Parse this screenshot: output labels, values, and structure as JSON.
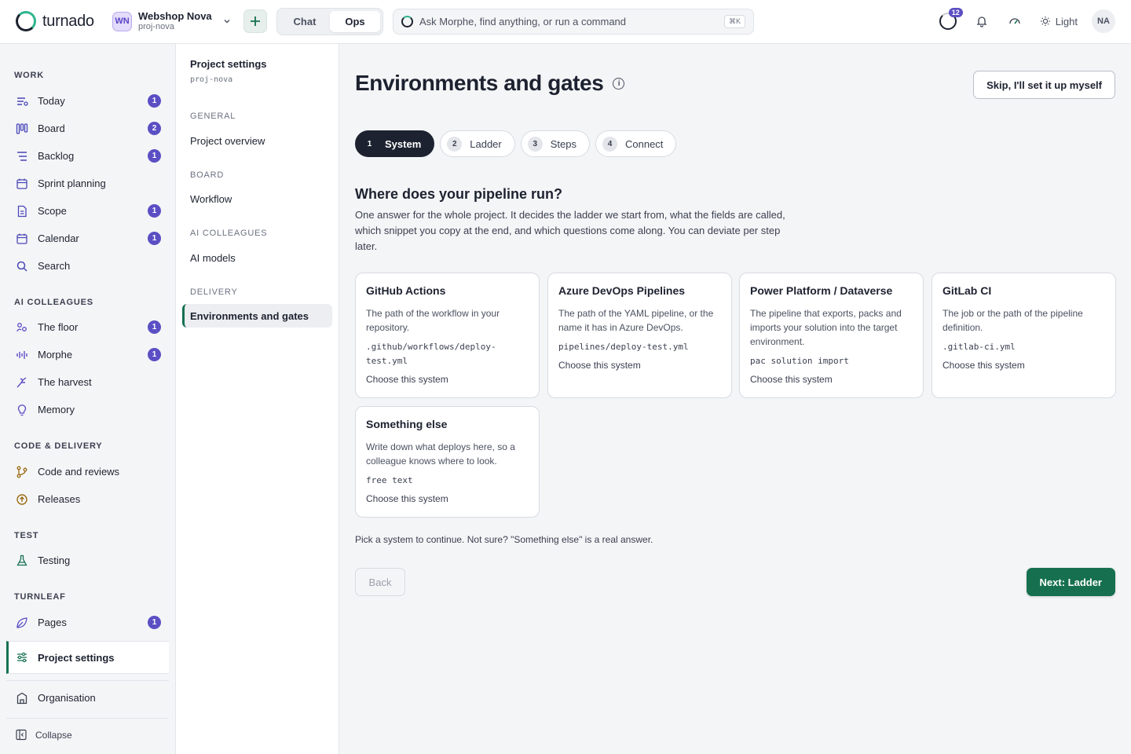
{
  "app": {
    "name": "turnado"
  },
  "workspace": {
    "initials": "WN",
    "name": "Webshop Nova",
    "slug": "proj-nova"
  },
  "mode_switch": {
    "chat": "Chat",
    "ops": "Ops",
    "selected": "Ops"
  },
  "command_bar": {
    "placeholder": "Ask Morphe, find anything, or run a command",
    "shortcut": "⌘K"
  },
  "topbar": {
    "activity_count": "12",
    "theme_label": "Light",
    "user_initials": "NA"
  },
  "nav": {
    "sections": {
      "work": "WORK",
      "ai": "AI COLLEAGUES",
      "code": "CODE & DELIVERY",
      "test": "TEST",
      "turnleaf": "TURNLEAF"
    },
    "items": {
      "today": {
        "label": "Today",
        "badge": "1"
      },
      "board": {
        "label": "Board",
        "badge": "2"
      },
      "backlog": {
        "label": "Backlog",
        "badge": "1"
      },
      "sprint": {
        "label": "Sprint planning"
      },
      "scope": {
        "label": "Scope",
        "badge": "1"
      },
      "calendar": {
        "label": "Calendar",
        "badge": "1"
      },
      "search": {
        "label": "Search"
      },
      "floor": {
        "label": "The floor",
        "badge": "1"
      },
      "morphe": {
        "label": "Morphe",
        "badge": "1"
      },
      "harvest": {
        "label": "The harvest"
      },
      "memory": {
        "label": "Memory"
      },
      "code": {
        "label": "Code and reviews"
      },
      "releases": {
        "label": "Releases"
      },
      "testing": {
        "label": "Testing"
      },
      "pages": {
        "label": "Pages",
        "badge": "1"
      },
      "settings": {
        "label": "Project settings"
      },
      "organisation": {
        "label": "Organisation"
      },
      "collapse": {
        "label": "Collapse"
      }
    }
  },
  "subnav": {
    "title": "Project settings",
    "slug": "proj-nova",
    "general": "GENERAL",
    "project_overview": "Project overview",
    "board": "BOARD",
    "workflow": "Workflow",
    "ai": "AI COLLEAGUES",
    "ai_models": "AI models",
    "delivery": "DELIVERY",
    "environments": "Environments and gates"
  },
  "main": {
    "title": "Environments and gates",
    "skip_label": "Skip, I'll set it up myself",
    "steps": [
      {
        "num": "1",
        "label": "System"
      },
      {
        "num": "2",
        "label": "Ladder"
      },
      {
        "num": "3",
        "label": "Steps"
      },
      {
        "num": "4",
        "label": "Connect"
      }
    ],
    "question": "Where does your pipeline run?",
    "description": "One answer for the whole project. It decides the ladder we start from, what the fields are called, which snippet you copy at the end, and which questions come along. You can deviate per step later.",
    "choose_label": "Choose this system",
    "systems": [
      {
        "title": "GitHub Actions",
        "description": "The path of the workflow in your repository.",
        "code": ".github/workflows/deploy-test.yml"
      },
      {
        "title": "Azure DevOps Pipelines",
        "description": "The path of the YAML pipeline, or the name it has in Azure DevOps.",
        "code": "pipelines/deploy-test.yml"
      },
      {
        "title": "Power Platform / Dataverse",
        "description": "The pipeline that exports, packs and imports your solution into the target environment.",
        "code": "pac solution import"
      },
      {
        "title": "GitLab CI",
        "description": "The job or the path of the pipeline definition.",
        "code": ".gitlab-ci.yml"
      },
      {
        "title": "Something else",
        "description": "Write down what deploys here, so a colleague knows where to look.",
        "code": "free text"
      }
    ],
    "hint": "Pick a system to continue. Not sure? \"Something else\" is a real answer.",
    "back_label": "Back",
    "next_label": "Next: Ladder"
  }
}
